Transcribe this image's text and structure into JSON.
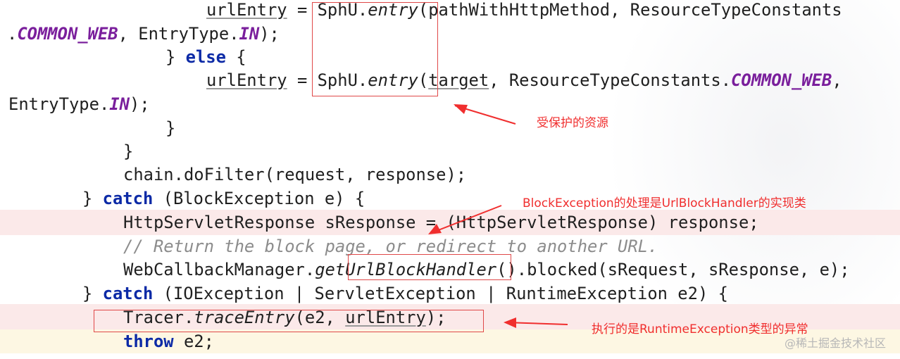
{
  "code": {
    "l1": {
      "a": "urlEntry",
      "b": " = ",
      "c": "SphU.",
      "d": "entry",
      "e": "(pathWithHttpMethod, ResourceTypeConstants"
    },
    "l2": {
      "a": ".",
      "b": "COMMON_WEB",
      "c": ", EntryType.",
      "d": "IN",
      "e": ");"
    },
    "l3": {
      "a": "} ",
      "b": "else",
      "c": " {"
    },
    "l4": {
      "a": "urlEntry",
      "b": " = SphU.",
      "c": "entry",
      "d": "(",
      "e": "target",
      "f": ", ResourceTypeConstants.",
      "g": "COMMON_WEB",
      "h": ","
    },
    "l5": {
      "a": "EntryType.",
      "b": "IN",
      "c": ");"
    },
    "l6": "}",
    "l7": "}",
    "l8": "chain.doFilter(request, response);",
    "l9": {
      "a": "} ",
      "b": "catch",
      "c": " (BlockException e) {"
    },
    "l10": "HttpServletResponse sResponse = (HttpServletResponse) response;",
    "l11": "// Return the block page, or redirect to another URL.",
    "l12": {
      "a": "WebCallbackManager.",
      "b": "getUrlBlockHandler",
      "c": "().blocked(sRequest, sResponse, e);"
    },
    "l13": {
      "a": "} ",
      "b": "catch",
      "c": " (IOException | ServletException | RuntimeException e2) {"
    },
    "l14": {
      "a": "Tracer.",
      "b": "traceEntry",
      "c": "(e2, ",
      "d": "urlEntry",
      "e": ");"
    },
    "l15": {
      "a": "throw",
      "b": " e2;"
    }
  },
  "annotations": {
    "protected_resource": "受保护的资源",
    "block_handler": "BlockException的处理是UrlBlockHandler的实现类",
    "runtime_exception": "执行的是RuntimeException类型的异常"
  },
  "watermark": "@稀土掘金技术社区",
  "colors": {
    "keyword": "#0c2aa6",
    "constant": "#7a1f9c",
    "comment": "#8c8c8c",
    "annotation": "#f02e2e",
    "error_highlight": "#fbe9e9",
    "warning_highlight": "#fdf7e3"
  }
}
